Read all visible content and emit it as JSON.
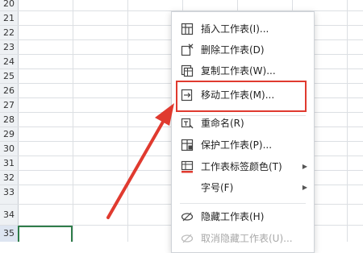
{
  "row_numbers": [
    "20",
    "21",
    "22",
    "23",
    "24",
    "25",
    "26",
    "27",
    "28",
    "29",
    "30",
    "31",
    "32",
    "33",
    "34",
    "35"
  ],
  "context_menu": {
    "items": [
      {
        "id": "insert",
        "label": "插入工作表(I)...",
        "icon": "insert-sheet-icon"
      },
      {
        "id": "delete",
        "label": "删除工作表(D)",
        "icon": "delete-sheet-icon"
      },
      {
        "id": "copy",
        "label": "复制工作表(W)...",
        "icon": "copy-sheet-icon"
      },
      {
        "id": "move",
        "label": "移动工作表(M)...",
        "icon": "move-sheet-icon"
      },
      {
        "id": "rename",
        "label": "重命名(R)",
        "icon": "rename-icon"
      },
      {
        "id": "protect",
        "label": "保护工作表(P)...",
        "icon": "protect-sheet-icon"
      },
      {
        "id": "tab-color",
        "label": "工作表标签颜色(T)",
        "icon": "tab-color-icon",
        "submenu": true
      },
      {
        "id": "font-size",
        "label": "字号(F)",
        "icon": "",
        "submenu": true
      },
      {
        "id": "hide",
        "label": "隐藏工作表(H)",
        "icon": "hide-eye-icon"
      },
      {
        "id": "unhide",
        "label": "取消隐藏工作表(U)...",
        "icon": "unhide-eye-icon",
        "disabled": true
      }
    ],
    "highlighted_item": "move"
  },
  "colors": {
    "highlight_border": "#e03a2f",
    "arrow": "#e03a2f",
    "active_cell_border": "#2f7d4a"
  }
}
